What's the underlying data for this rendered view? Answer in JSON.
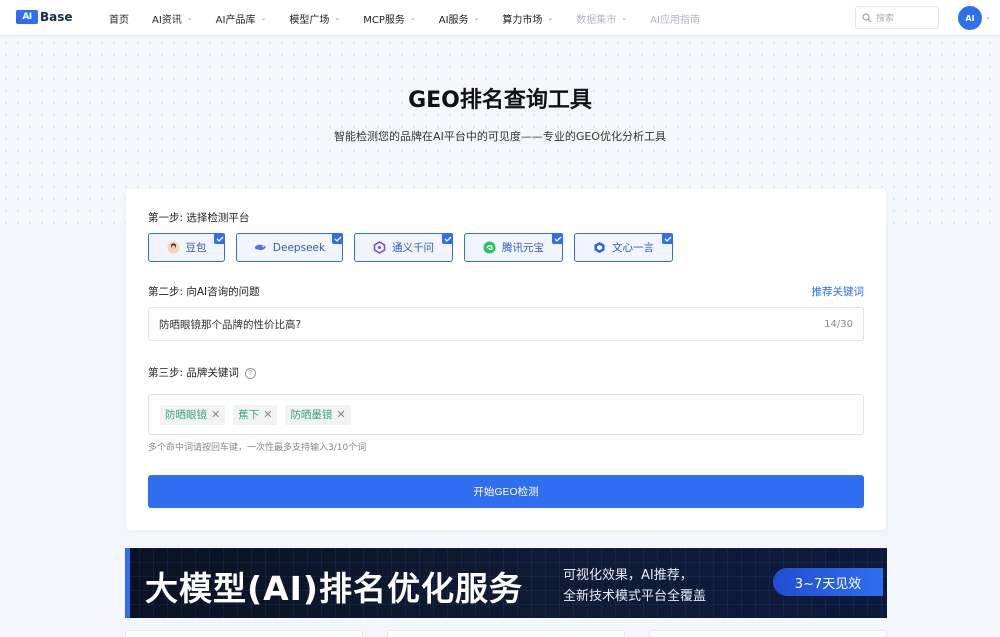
{
  "logo": {
    "mark": "AI",
    "text": "Base"
  },
  "nav": {
    "items": [
      {
        "label": "首页",
        "chevron": false,
        "dim": false
      },
      {
        "label": "AI资讯",
        "chevron": true,
        "dim": false
      },
      {
        "label": "AI产品库",
        "chevron": true,
        "dim": false
      },
      {
        "label": "模型广场",
        "chevron": true,
        "dim": false
      },
      {
        "label": "MCP服务",
        "chevron": true,
        "dim": false
      },
      {
        "label": "AI服务",
        "chevron": true,
        "dim": false
      },
      {
        "label": "算力市场",
        "chevron": true,
        "dim": false
      },
      {
        "label": "数据集市",
        "chevron": true,
        "dim": true
      },
      {
        "label": "AI应用指南",
        "chevron": false,
        "dim": true
      }
    ],
    "search_placeholder": "搜索",
    "avatar_text": "AI"
  },
  "hero": {
    "title": "GEO排名查询工具",
    "subtitle": "智能检测您的品牌在AI平台中的可见度——专业的GEO优化分析工具"
  },
  "form": {
    "step1_label": "第一步: 选择检测平台",
    "platforms": [
      {
        "label": "豆包",
        "icon": "doubao-icon",
        "checked": true
      },
      {
        "label": "Deepseek",
        "icon": "deepseek-icon",
        "checked": true
      },
      {
        "label": "通义千问",
        "icon": "tongyi-icon",
        "checked": true
      },
      {
        "label": "腾讯元宝",
        "icon": "yuanbao-icon",
        "checked": true
      },
      {
        "label": "文心一言",
        "icon": "wenxin-icon",
        "checked": true
      }
    ],
    "step2_label": "第二步: 向AI咨询的问题",
    "recommend_link": "推荐关键词",
    "question_value": "防晒眼镜那个品牌的性价比高?",
    "question_count": "14/30",
    "step3_label": "第三步: 品牌关键词",
    "keywords": [
      "防晒眼镜",
      "蕉下",
      "防晒墨镜"
    ],
    "hint": "多个命中词请按回车键，一次性最多支持输入3/10个词",
    "submit_label": "开始GEO检测"
  },
  "banner": {
    "title": "大模型(AI)排名优化服务",
    "sub_line1": "可视化效果，AI推荐，",
    "sub_line2": "全新技术模式平台全覆盖",
    "badge": "3~7天见效"
  },
  "colors": {
    "accent": "#2f6ef0",
    "tag_text": "#3aa57a"
  }
}
